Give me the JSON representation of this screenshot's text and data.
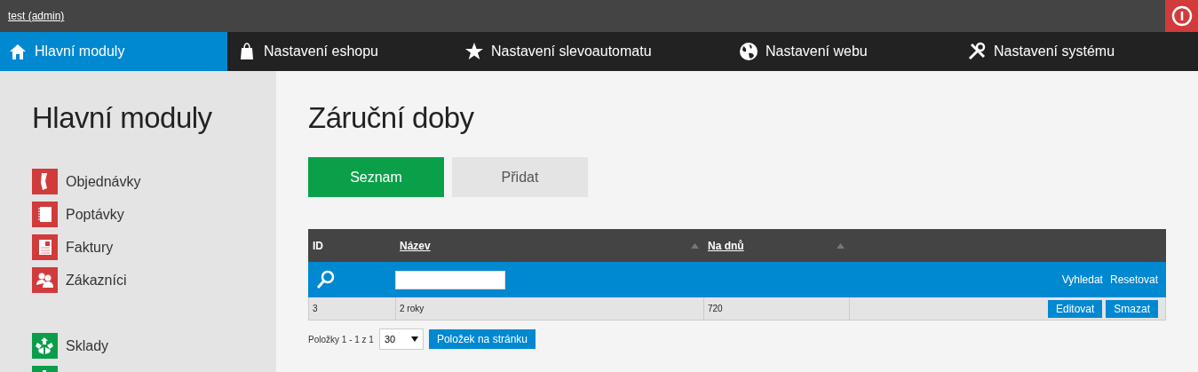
{
  "top_bar": {
    "user_link": "test (admin)"
  },
  "nav": {
    "items": [
      {
        "label": "Hlavní moduly",
        "selected": true
      },
      {
        "label": "Nastavení eshopu",
        "selected": false
      },
      {
        "label": "Nastavení slevoautomatu",
        "selected": false
      },
      {
        "label": "Nastavení webu",
        "selected": false
      },
      {
        "label": "Nastavení systému",
        "selected": false
      }
    ]
  },
  "sidebar": {
    "title": "Hlavní moduly",
    "groups": [
      {
        "items": [
          {
            "label": "Objednávky",
            "color": "#d13b3b"
          },
          {
            "label": "Poptávky",
            "color": "#d13b3b"
          },
          {
            "label": "Faktury",
            "color": "#d13b3b"
          },
          {
            "label": "Zákazníci",
            "color": "#d13b3b"
          }
        ]
      },
      {
        "items": [
          {
            "label": "Sklady",
            "color": "#0a9e4a"
          },
          {
            "color": "#0a9e4a"
          }
        ]
      }
    ]
  },
  "main": {
    "title": "Záruční doby",
    "tabs": [
      {
        "label": "Seznam",
        "selected": true
      },
      {
        "label": "Přidat",
        "selected": false
      }
    ],
    "table": {
      "columns": [
        {
          "label": "ID",
          "sortable": false
        },
        {
          "label": "Název",
          "sortable": true
        },
        {
          "label": "Na dnů",
          "sortable": true
        }
      ],
      "filter": {
        "actions": [
          "Vyhledat",
          "Resetovat"
        ]
      },
      "rows": [
        {
          "cells": [
            "3",
            "2 roky",
            "720"
          ],
          "actions": [
            "Editovat",
            "Smazat"
          ]
        }
      ]
    },
    "pagination": {
      "summary": "Položky 1 - 1 z 1",
      "page_size": "30",
      "button": "Položek na stránku"
    }
  }
}
